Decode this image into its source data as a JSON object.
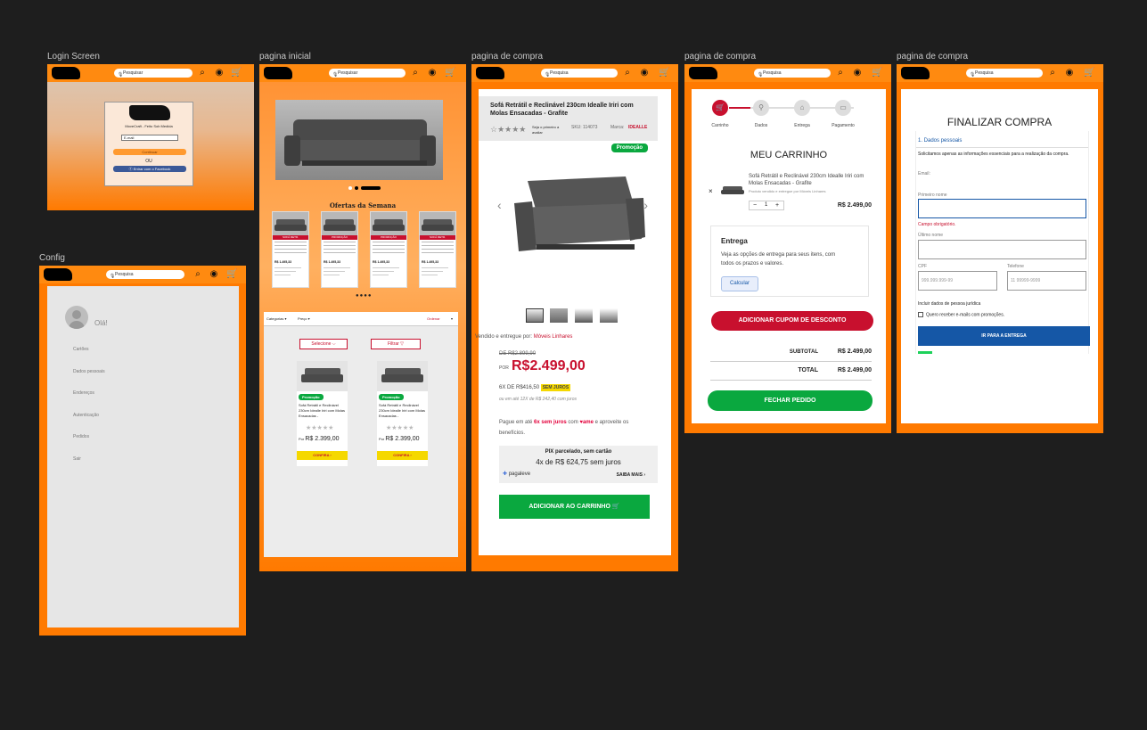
{
  "titles": {
    "login": "Login Screen",
    "home": "pagina inicial",
    "product": "pagina de compra",
    "cart": "pagina de compra",
    "checkout": "pagina de compra",
    "config": "Config"
  },
  "search": {
    "placeholder_login": "Pesquisar",
    "placeholder_home": "Pesquisar",
    "placeholder_product": "Pesquisa",
    "placeholder_cart": "Pesquisa",
    "placeholder_checkout": "Pesquisa",
    "placeholder_config": "Pesquisa"
  },
  "login": {
    "tagline": "MoveCraft - Feito Sob Medida",
    "email_placeholder": "E-mail",
    "continue": "Continuar",
    "or": "OU",
    "facebook": "Entrar com o Facebook"
  },
  "home": {
    "offers_title": "Ofertas da Semana",
    "offer_cards": [
      {
        "badge": "SOFÁ RETR.",
        "price": "R$ 1.495,33"
      },
      {
        "badge": "PROMOÇÃO",
        "price": "R$ 1.495,33"
      },
      {
        "badge": "PROMOÇÃO",
        "price": "R$ 1.495,33"
      },
      {
        "badge": "SOFÁ RETR.",
        "price": "R$ 1.495,33"
      }
    ],
    "filter_categories": "Categorias",
    "filter_price": "Preço",
    "filter_sort": "Ordenar",
    "select_btn": "Selecione",
    "filter_btn": "Filtrar",
    "products": [
      {
        "badge": "Promoção",
        "name": "Sofá Retrátil e Reclinável 230cm Idealle Iriri com Molas Ensacadas -",
        "price_prefix": "Por",
        "price": "R$ 2.399,00",
        "cta": "CONFIRA"
      },
      {
        "badge": "Promoção",
        "name": "Sofá Retrátil e Reclinável 230cm Idealle Iriri com Molas Ensacadas -",
        "price_prefix": "Por",
        "price": "R$ 2.399,00",
        "cta": "CONFIRA"
      }
    ]
  },
  "product": {
    "title": "Sofá Retrátil e Reclinável 230cm Idealle Iriri com Molas Ensacadas - Grafite",
    "rating_text": "Seja o primeiro a avaliar",
    "sku": "SKU: 114073",
    "brand_label": "Marca:",
    "brand": "IDEALLE",
    "promo": "Promoção",
    "sold_by": "Vendido e entregue por:",
    "seller": "Móveis Linhares",
    "old_price": "DE R$2.899,90",
    "price_prefix": "POR",
    "price": "R$2.499,00",
    "installments": "6X DE R$416,50",
    "no_interest": "SEM JUROS",
    "alt_installments": "ou em até 12X de R$ 242,40 com juros",
    "ame_text_1": "Pague em até",
    "ame_highlight": "6x sem juros",
    "ame_text_2": "com",
    "ame_brand": "ame",
    "ame_text_3": "e aproveite os benefícios.",
    "pix_title": "PIX parcelado, sem cartão",
    "pix_value": "4x de R$ 624,75 sem juros",
    "pagaleve": "pagaleve",
    "learn_more": "SAIBA MAIS",
    "add_to_cart": "ADICIONAR AO CARRINHO"
  },
  "cart": {
    "steps": [
      "Carrinho",
      "Dados",
      "Entrega",
      "Pagamento"
    ],
    "title": "MEU CARRINHO",
    "item_name": "Sofá Retrátil e Reclinável 230cm Idealle Iriri com Molas Ensacadas - Grafite",
    "item_seller": "Produto vendido e entregue por Móveis Linhares",
    "qty": "1",
    "item_price": "R$ 2.499,00",
    "delivery_title": "Entrega",
    "delivery_text": "Veja as opções de entrega para seus itens, com todos os prazos e valores.",
    "calc_btn": "Calcular",
    "coupon_btn": "ADICIONAR CUPOM DE DESCONTO",
    "subtotal_label": "SUBTOTAL",
    "subtotal": "R$ 2.499,00",
    "total_label": "TOTAL",
    "total": "R$ 2.499,00",
    "checkout_btn": "FECHAR PEDIDO"
  },
  "checkout": {
    "title": "FINALIZAR COMPRA",
    "section": "1. Dados pessoais",
    "intro": "Solicitamos apenas as informações essenciais para a realização da compra.",
    "email_label": "Email:",
    "first_name_label": "Primeiro nome",
    "required_msg": "Campo obrigatório.",
    "last_name_label": "Último nome",
    "cpf_label": "CPF",
    "cpf_placeholder": "999.999.999-99",
    "phone_label": "Telefone",
    "phone_placeholder": "11 99999-9999",
    "company_link": "Incluir dados de pessoa jurídica",
    "newsletter": "Quero receber e-mails com promoções.",
    "next_btn": "IR PARA A ENTREGA"
  },
  "config": {
    "greeting": "Olá!",
    "menu": [
      "Cartões",
      "Dados pessoais",
      "Endereços",
      "Autenticação",
      "Pedidos",
      "Sair"
    ]
  },
  "colors": {
    "orange": "#ff7a00",
    "red": "#c8102e",
    "green": "#0aa83f",
    "blue": "#1557a6",
    "yellow": "#f5d800"
  }
}
